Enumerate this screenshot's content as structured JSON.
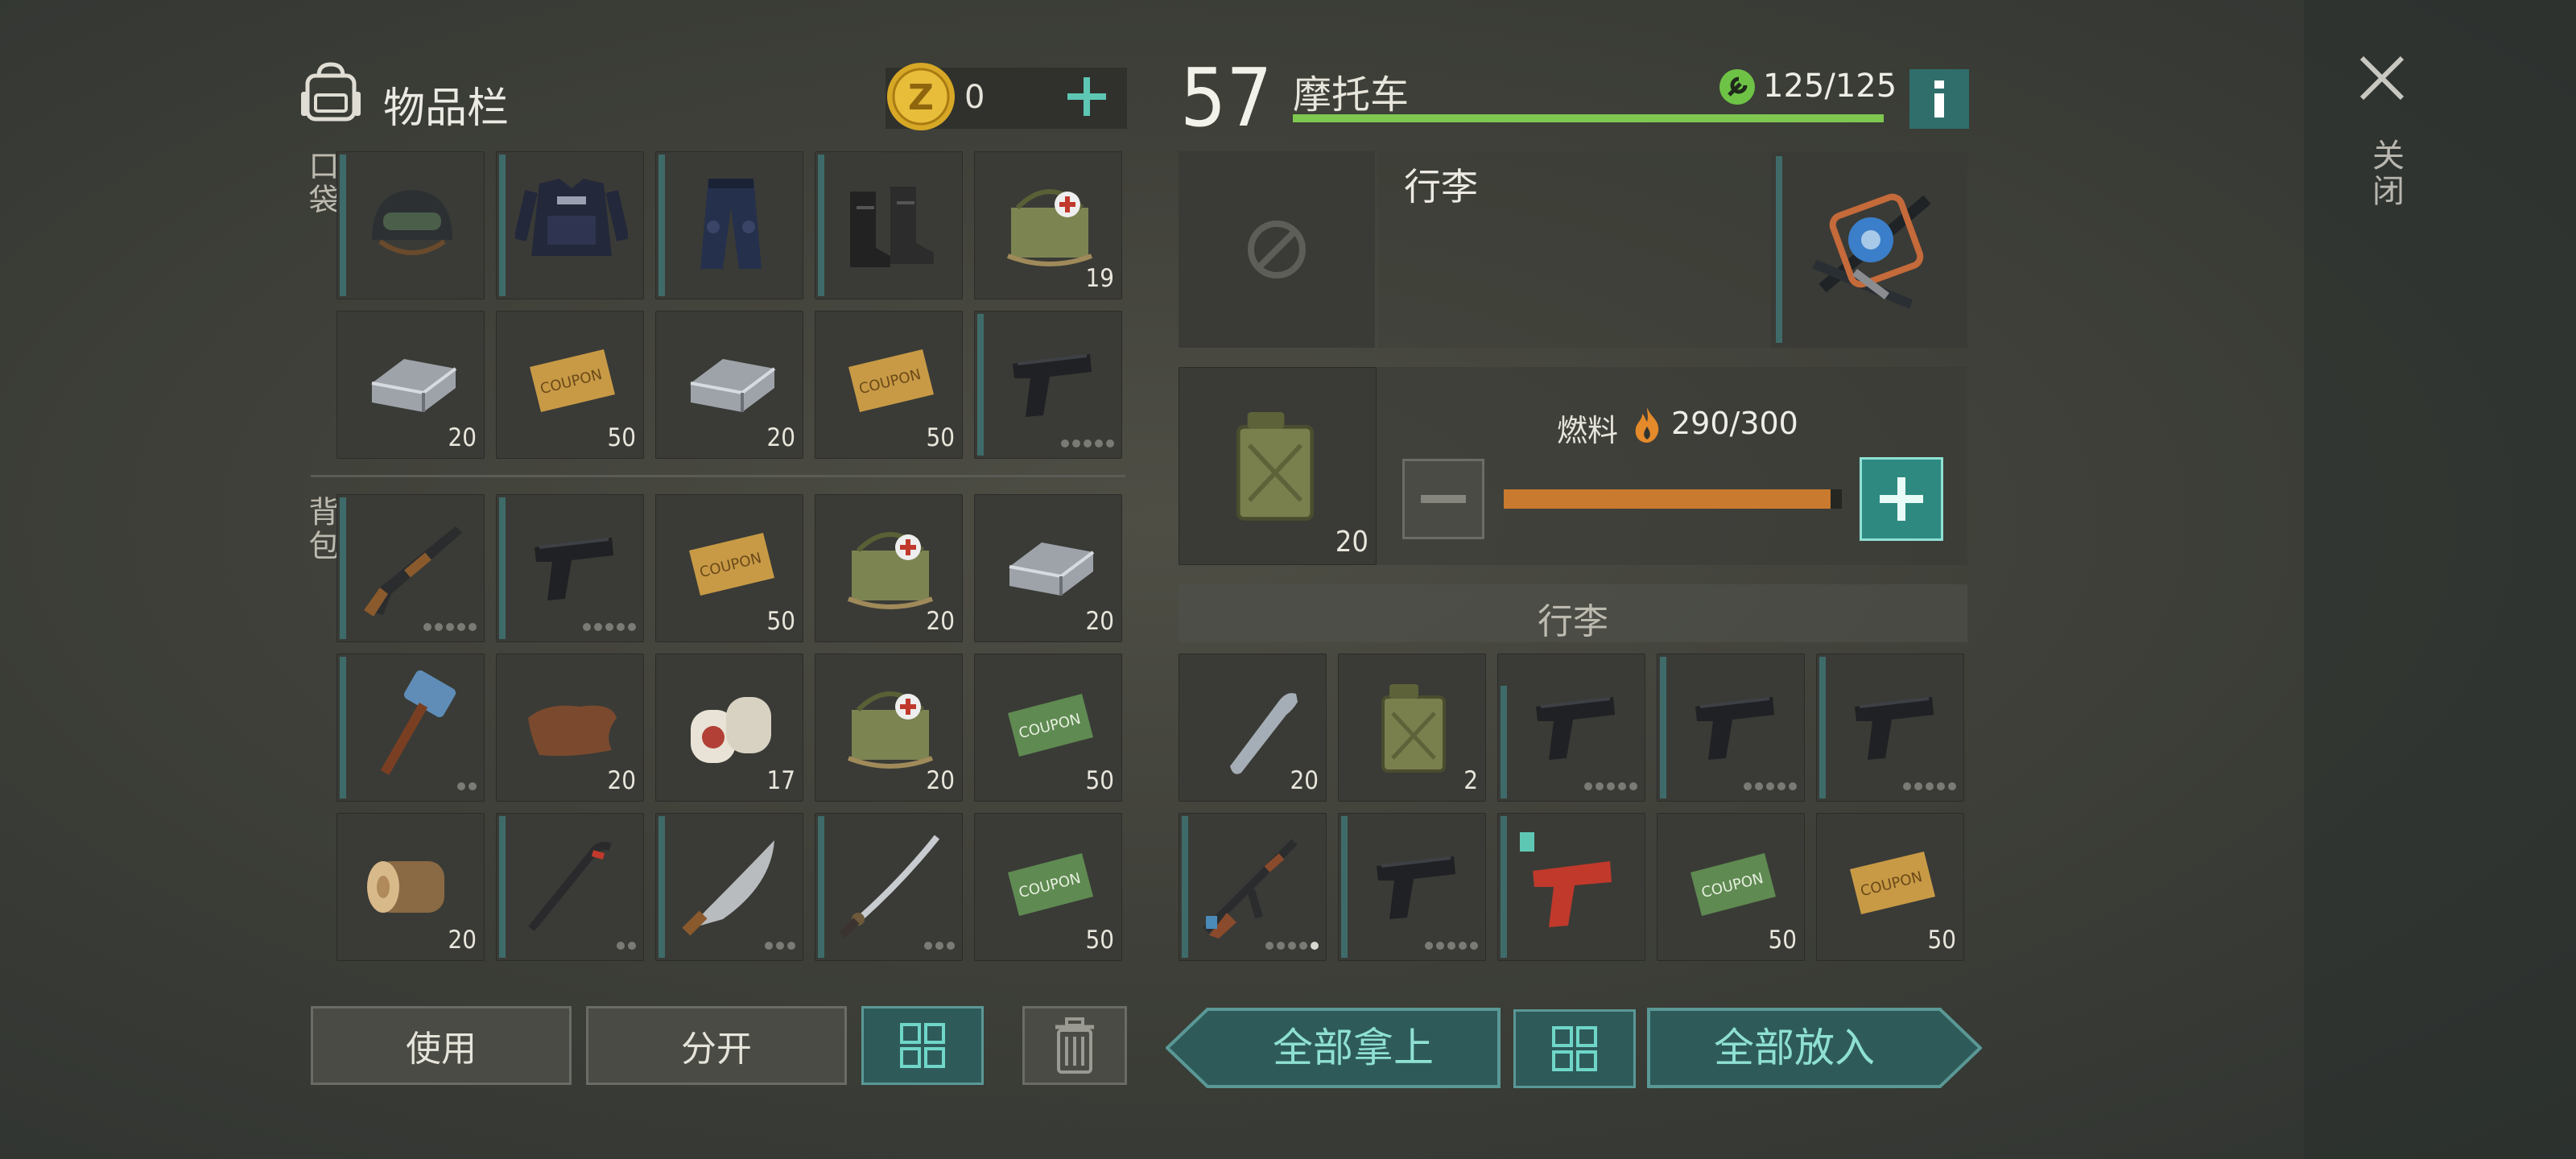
{
  "inventory": {
    "title": "物品栏",
    "coins": "0",
    "pockets_label": "口袋",
    "backpack_label": "背包",
    "pockets": [
      {
        "icon": "helmet-icon",
        "count": "",
        "bar": true,
        "dots": 0
      },
      {
        "icon": "armor-vest-icon",
        "count": "",
        "bar": true,
        "dots": 0
      },
      {
        "icon": "pants-icon",
        "count": "",
        "bar": true,
        "dots": 0
      },
      {
        "icon": "boots-icon",
        "count": "",
        "bar": true,
        "dots": 0
      },
      {
        "icon": "medkit-bag-icon",
        "count": "19",
        "bar": false,
        "dots": 0
      },
      {
        "icon": "iron-ingot-icon",
        "count": "20",
        "bar": false,
        "dots": 0
      },
      {
        "icon": "survival-coupon-icon",
        "count": "50",
        "bar": false,
        "dots": 0
      },
      {
        "icon": "iron-ingot-icon",
        "count": "20",
        "bar": false,
        "dots": 0
      },
      {
        "icon": "survival-coupon-icon",
        "count": "50",
        "bar": false,
        "dots": 0
      },
      {
        "icon": "pistol-icon",
        "count": "",
        "bar": true,
        "dots": 5
      }
    ],
    "backpack": [
      {
        "icon": "shotgun-icon",
        "count": "",
        "bar": true,
        "dots": 5
      },
      {
        "icon": "pistol-icon",
        "count": "",
        "bar": true,
        "dots": 5
      },
      {
        "icon": "survival-coupon-icon",
        "count": "50",
        "bar": false,
        "dots": 0
      },
      {
        "icon": "medkit-bag-icon",
        "count": "20",
        "bar": false,
        "dots": 0
      },
      {
        "icon": "iron-ingot-icon",
        "count": "20",
        "bar": false,
        "dots": 0
      },
      {
        "icon": "sledgehammer-icon",
        "count": "",
        "bar": true,
        "dots": 2
      },
      {
        "icon": "leather-icon",
        "count": "20",
        "bar": false,
        "dots": 0
      },
      {
        "icon": "bandage-icon",
        "count": "17",
        "bar": false,
        "dots": 0
      },
      {
        "icon": "medkit-bag-icon",
        "count": "20",
        "bar": false,
        "dots": 0
      },
      {
        "icon": "ration-coupon-icon",
        "count": "50",
        "bar": false,
        "dots": 0
      },
      {
        "icon": "log-icon",
        "count": "20",
        "bar": false,
        "dots": 0
      },
      {
        "icon": "crowbar-icon",
        "count": "",
        "bar": true,
        "dots": 2
      },
      {
        "icon": "machete-icon",
        "count": "",
        "bar": true,
        "dots": 3
      },
      {
        "icon": "katana-icon",
        "count": "",
        "bar": true,
        "dots": 3
      },
      {
        "icon": "ration-coupon-icon",
        "count": "50",
        "bar": false,
        "dots": 0
      }
    ],
    "use_label": "使用",
    "split_label": "分开"
  },
  "vehicle": {
    "level": "57",
    "name": "摩托车",
    "durability": "125/125",
    "durability_fraction": 1.0,
    "slot_title": "行李",
    "fuel_label": "燃料",
    "fuel_value": "290/300",
    "fuel_fraction": 0.967,
    "fuel_can_count": "20",
    "cargo_title": "行李",
    "cargo": [
      {
        "icon": "water-bottle-icon",
        "count": "20",
        "bar": false,
        "dots": 0
      },
      {
        "icon": "fuel-can-icon",
        "count": "2",
        "bar": false,
        "dots": 0
      },
      {
        "icon": "pistol-icon",
        "count": "",
        "bar": true,
        "short": true,
        "dots": 5
      },
      {
        "icon": "pistol-icon",
        "count": "",
        "bar": true,
        "dots": 5
      },
      {
        "icon": "pistol-icon",
        "count": "",
        "bar": true,
        "dots": 5
      },
      {
        "icon": "ak-rifle-icon",
        "count": "",
        "bar": true,
        "dots": 5,
        "lastWhite": true
      },
      {
        "icon": "pistol-icon",
        "count": "",
        "bar": true,
        "dots": 5
      },
      {
        "icon": "flare-gun-icon",
        "count": "",
        "bar": true,
        "dots": 0
      },
      {
        "icon": "ration-coupon-icon",
        "count": "50",
        "bar": false,
        "dots": 0
      },
      {
        "icon": "survival-coupon-icon",
        "count": "50",
        "bar": false,
        "dots": 0
      }
    ],
    "take_all_label": "全部拿上",
    "put_all_label": "全部放入"
  },
  "close_label": "关闭",
  "colors": {
    "accent": "#5ec7b4",
    "durability": "#7ec850",
    "fuel": "#c97a2e",
    "panel": "#3a3b36"
  }
}
